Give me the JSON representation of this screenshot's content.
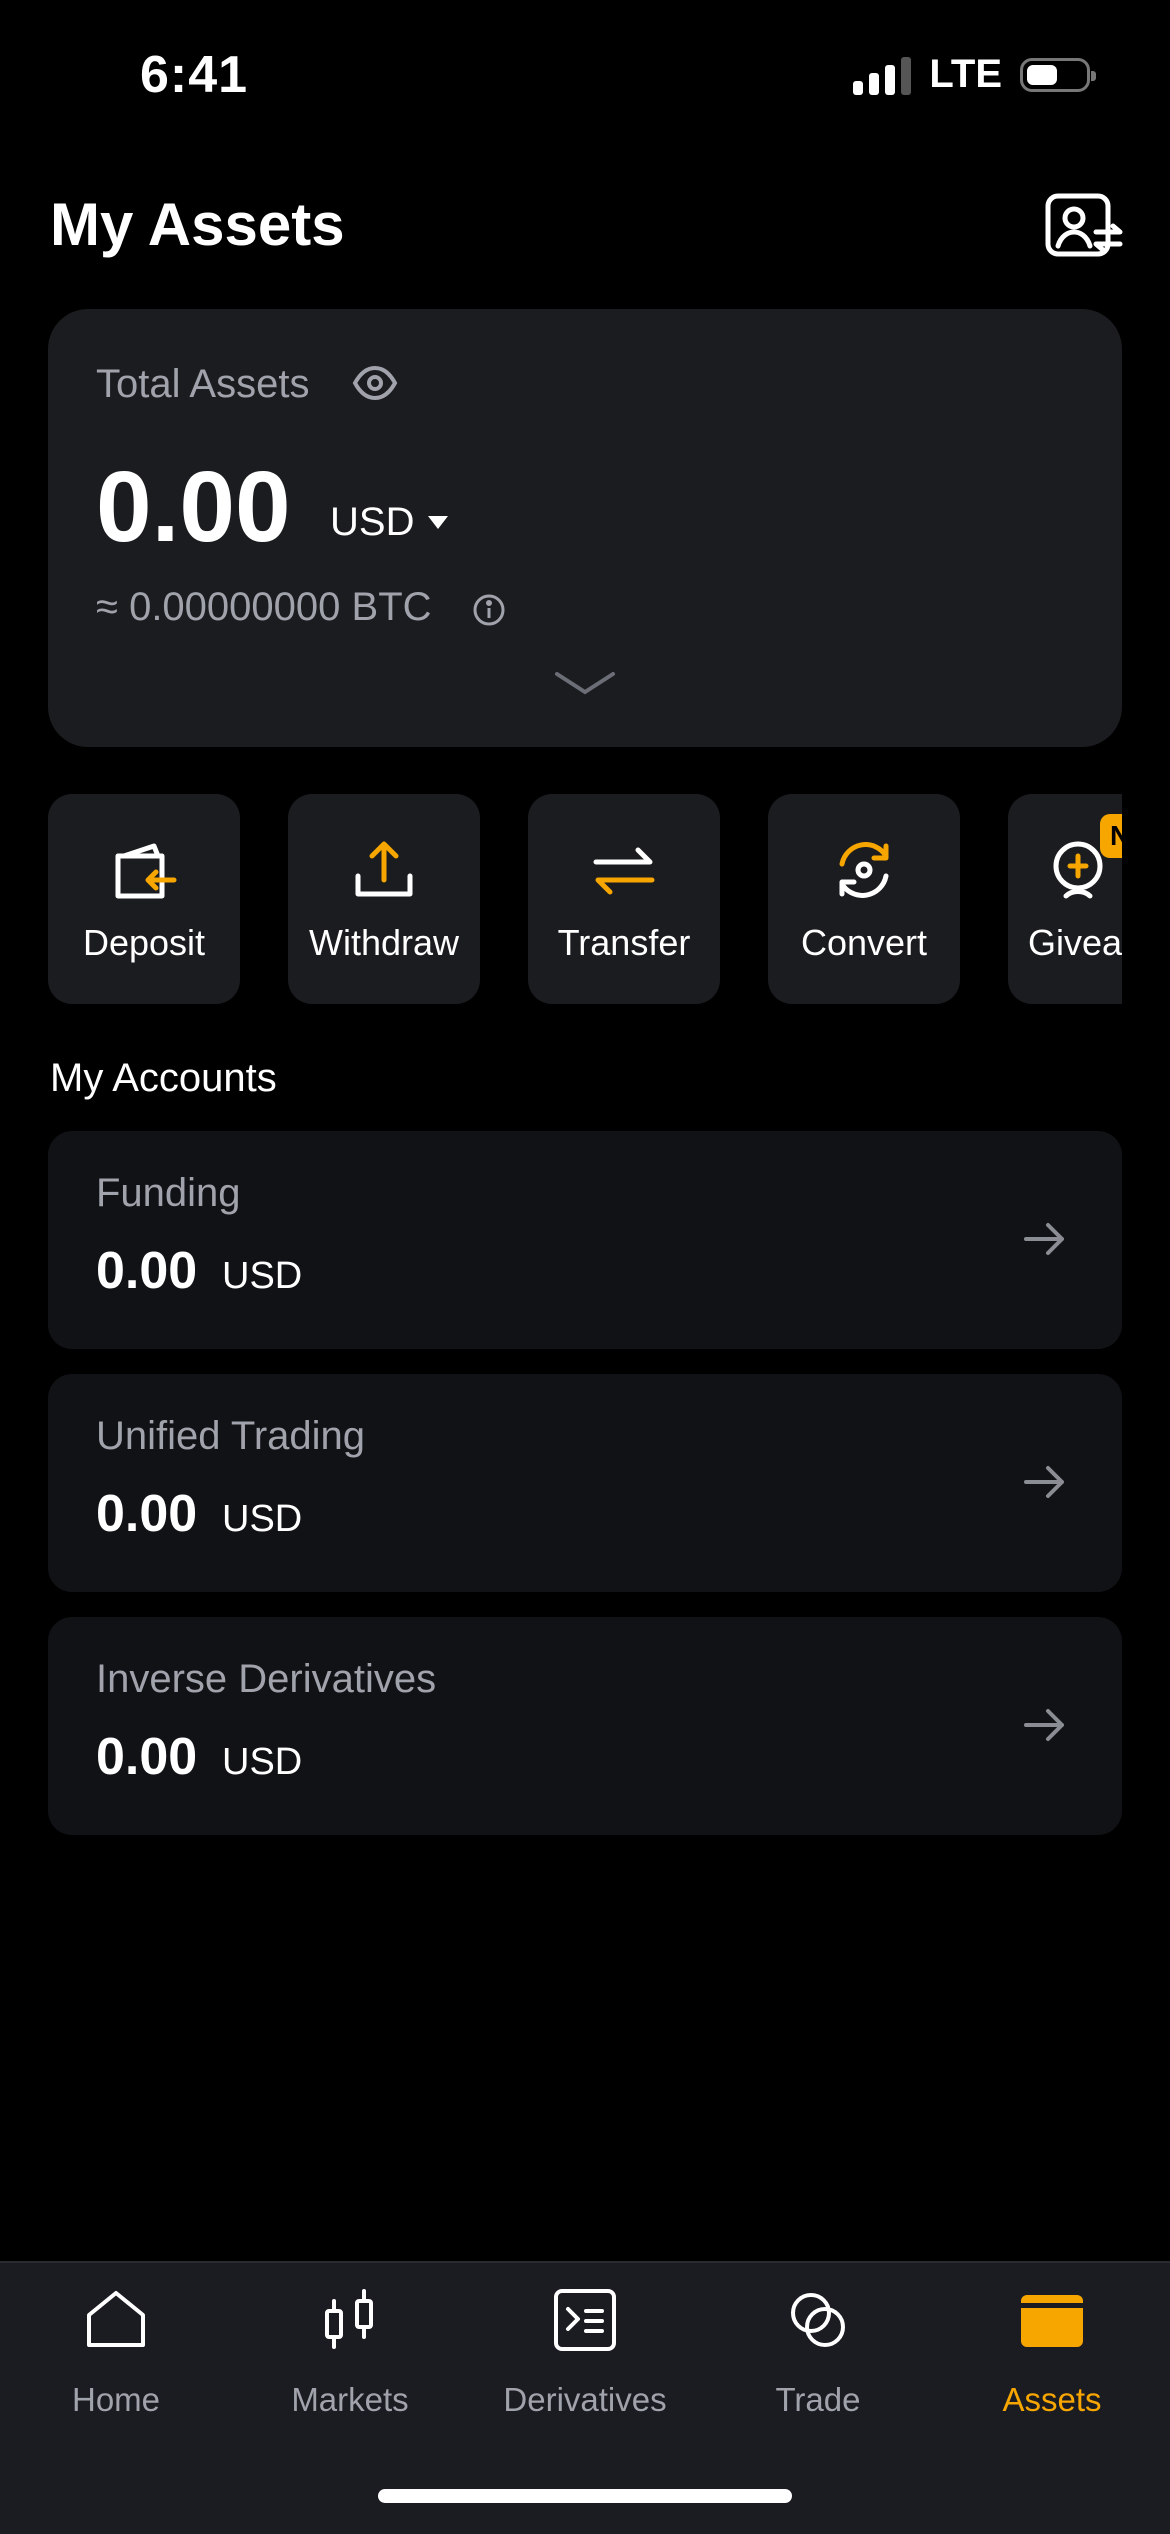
{
  "status_bar": {
    "time": "6:41",
    "network": "LTE"
  },
  "header": {
    "title": "My Assets",
    "profile_icon": "profile-switch-icon"
  },
  "total_assets": {
    "label": "Total Assets",
    "value": "0.00",
    "currency": "USD",
    "btc_equivalent": "≈ 0.00000000 BTC"
  },
  "actions": [
    {
      "label": "Deposit",
      "icon": "deposit-icon"
    },
    {
      "label": "Withdraw",
      "icon": "withdraw-icon"
    },
    {
      "label": "Transfer",
      "icon": "transfer-icon"
    },
    {
      "label": "Convert",
      "icon": "convert-icon"
    },
    {
      "label": "Giveaway",
      "icon": "giveaway-icon",
      "badge": "N"
    }
  ],
  "accounts_section": {
    "title": "My Accounts",
    "items": [
      {
        "name": "Funding",
        "value": "0.00",
        "unit": "USD"
      },
      {
        "name": "Unified Trading",
        "value": "0.00",
        "unit": "USD"
      },
      {
        "name": "Inverse Derivatives",
        "value": "0.00",
        "unit": "USD"
      }
    ]
  },
  "bottom_nav": {
    "items": [
      {
        "label": "Home",
        "icon": "home-icon"
      },
      {
        "label": "Markets",
        "icon": "candlestick-icon"
      },
      {
        "label": "Derivatives",
        "icon": "derivatives-icon"
      },
      {
        "label": "Trade",
        "icon": "trade-icon"
      },
      {
        "label": "Assets",
        "icon": "wallet-icon",
        "active": true
      }
    ]
  },
  "colors": {
    "accent": "#f7a600",
    "card": "#1b1c1f",
    "background": "#000000",
    "muted_text": "#a0a3ab"
  }
}
